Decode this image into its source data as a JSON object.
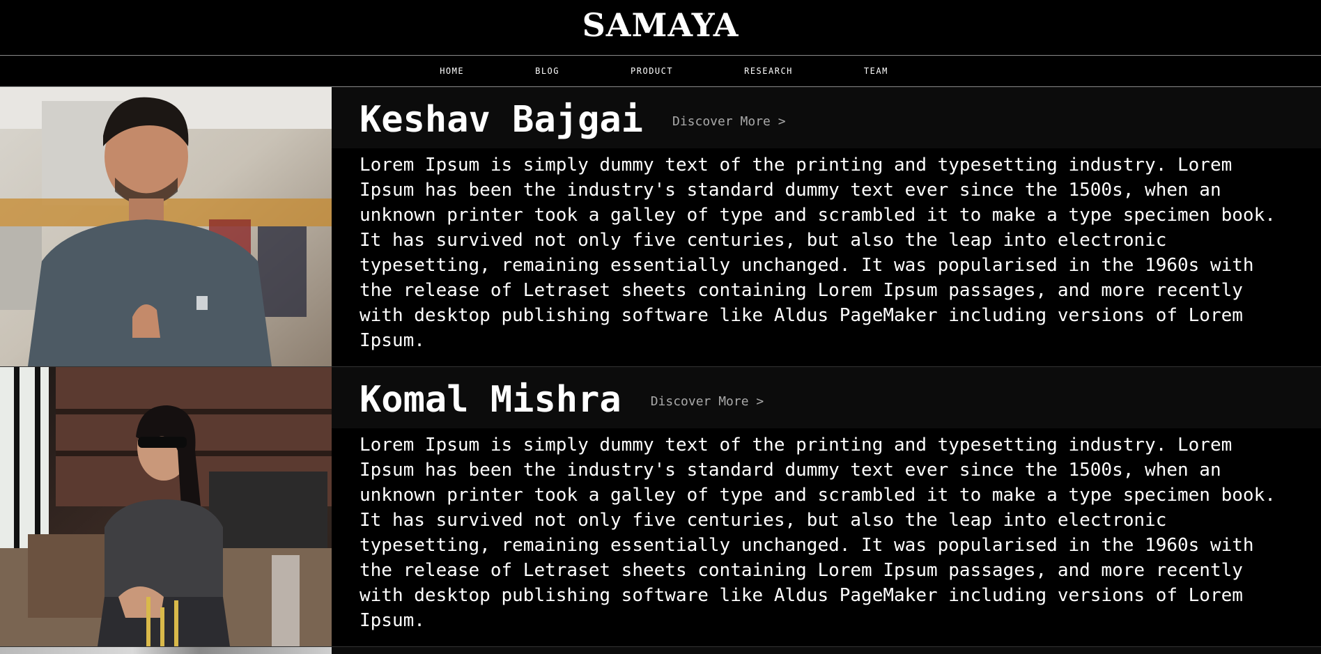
{
  "site": {
    "title": "SAMAYA"
  },
  "nav": {
    "items": [
      {
        "label": "HOME"
      },
      {
        "label": "BLOG"
      },
      {
        "label": "PRODUCT"
      },
      {
        "label": "RESEARCH"
      },
      {
        "label": "TEAM"
      }
    ]
  },
  "team": {
    "members": [
      {
        "name": "Keshav Bajgai",
        "discover_label": "Discover More >",
        "bio": "Lorem Ipsum is simply dummy text of the printing and typesetting industry. Lorem\nIpsum has been the industry's standard dummy text ever since the 1500s, when an\nunknown printer took a galley of type and scrambled it to make a type specimen book.\nIt has survived not only five centuries, but also the leap into electronic\ntypesetting, remaining essentially unchanged. It was popularised in the 1960s with\nthe release of Letraset sheets containing Lorem Ipsum passages, and more recently\nwith desktop publishing software like Aldus PageMaker including versions of Lorem\nIpsum."
      },
      {
        "name": "Komal Mishra",
        "discover_label": "Discover More >",
        "bio": "Lorem Ipsum is simply dummy text of the printing and typesetting industry. Lorem\nIpsum has been the industry's standard dummy text ever since the 1500s, when an\nunknown printer took a galley of type and scrambled it to make a type specimen book.\nIt has survived not only five centuries, but also the leap into electronic\ntypesetting, remaining essentially unchanged. It was popularised in the 1960s with\nthe release of Letraset sheets containing Lorem Ipsum passages, and more recently\nwith desktop publishing software like Aldus PageMaker including versions of Lorem\nIpsum."
      }
    ]
  },
  "colors": {
    "background": "#000000",
    "panel": "#0c0c0c",
    "text": "#ffffff",
    "muted": "#a9a9a9",
    "divider": "#8a8a8a"
  }
}
